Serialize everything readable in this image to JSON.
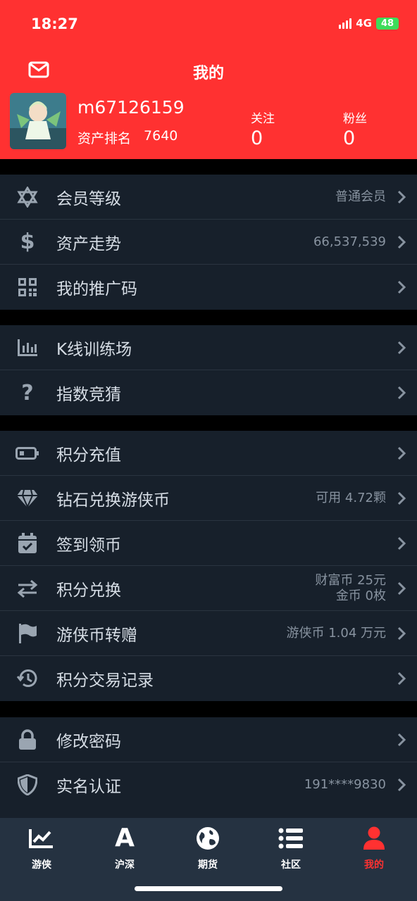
{
  "status_bar": {
    "time": "18:27",
    "network": "4G",
    "battery": "48"
  },
  "header": {
    "title": "我的",
    "username": "m67126159",
    "rank_label": "资产排名",
    "rank_value": "7640",
    "following_label": "关注",
    "following_value": "0",
    "fans_label": "粉丝",
    "fans_value": "0"
  },
  "menu": {
    "member_level": {
      "label": "会员等级",
      "value": "普通会员"
    },
    "asset_trend": {
      "label": "资产走势",
      "value": "66,537,539"
    },
    "promo_code": {
      "label": "我的推广码"
    },
    "kline_training": {
      "label": "K线训练场"
    },
    "index_guess": {
      "label": "指数竞猜"
    },
    "points_recharge": {
      "label": "积分充值"
    },
    "diamond_exchange": {
      "label": "钻石兑换游侠币",
      "value": "可用 4.72颗"
    },
    "sign_in": {
      "label": "签到领币"
    },
    "points_exchange": {
      "label": "积分兑换",
      "value_line1": "财富币 25元",
      "value_line2": "金币 0枚"
    },
    "coin_transfer": {
      "label": "游侠币转赠",
      "value": "游侠币 1.04 万元"
    },
    "points_history": {
      "label": "积分交易记录"
    },
    "change_password": {
      "label": "修改密码"
    },
    "real_name": {
      "label": "实名认证",
      "value": "191****9830"
    }
  },
  "tabbar": {
    "tabs": [
      {
        "label": "游侠"
      },
      {
        "label": "沪深"
      },
      {
        "label": "期货"
      },
      {
        "label": "社区"
      },
      {
        "label": "我的"
      }
    ]
  },
  "colors": {
    "accent": "#ff3131",
    "list_bg": "#17202b",
    "tabbar_bg": "#253241",
    "icon": "#9aa5b1"
  }
}
